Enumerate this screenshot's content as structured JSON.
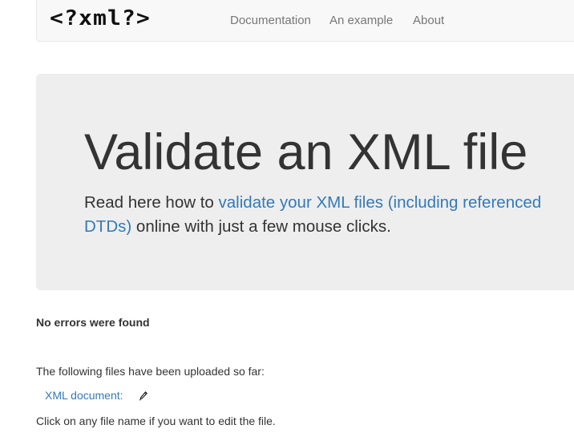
{
  "navbar": {
    "brand": "<?xml?>",
    "links": [
      "Documentation",
      "An example",
      "About"
    ]
  },
  "jumbotron": {
    "title": "Validate an XML file",
    "lead_prefix": "Read here how to ",
    "lead_link": "validate your XML files (including referenced DTDs)",
    "lead_suffix": " online with just a few mouse clicks."
  },
  "status": {
    "message": "No errors were found"
  },
  "files": {
    "intro": "The following files have been uploaded so far:",
    "items": [
      {
        "label": "XML document:",
        "icon": "pencil-icon"
      }
    ],
    "hint": "Click on any file name if you want to edit the file."
  },
  "colors": {
    "link": "#337ab7",
    "navbar_bg": "#f8f8f8",
    "jumbotron_bg": "#eeeeee",
    "text": "#333333"
  }
}
